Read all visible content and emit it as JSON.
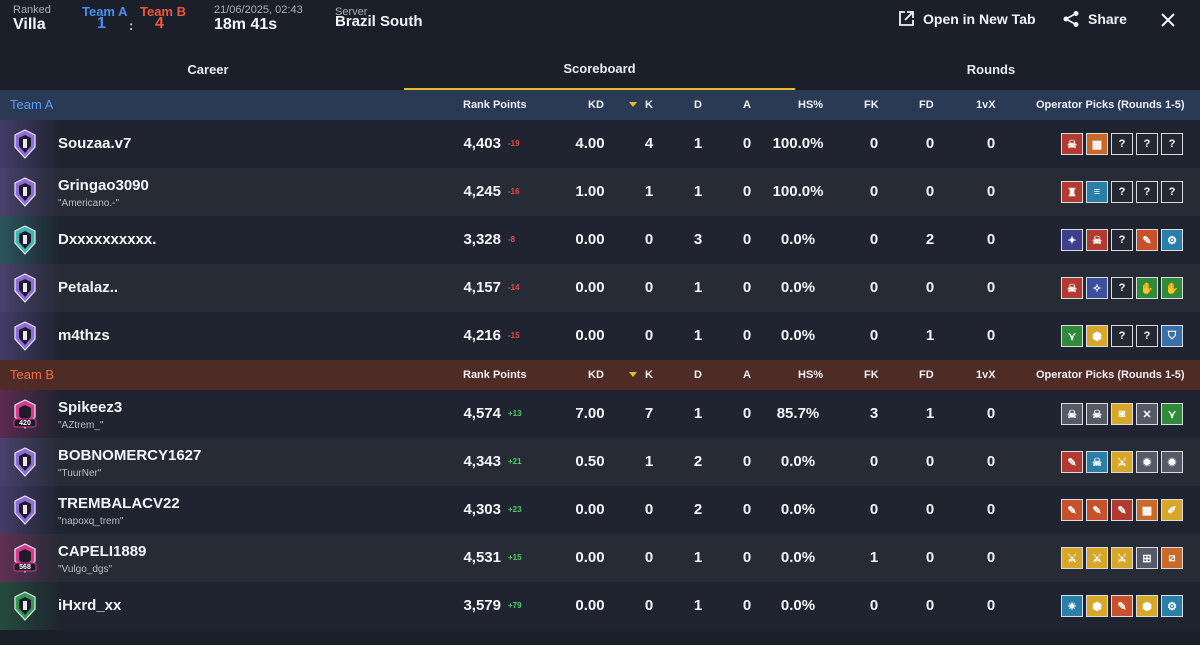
{
  "header": {
    "mode_label": "Ranked",
    "map": "Villa",
    "team_a_label": "Team A",
    "team_b_label": "Team B",
    "score_a": "1",
    "score_separator": ":",
    "score_b": "4",
    "datetime": "21/06/2025, 02:43",
    "duration": "18m 41s",
    "server_label": "Server",
    "server": "Brazil South",
    "open_new_tab": "Open in New Tab",
    "share": "Share"
  },
  "tabs": [
    {
      "label": "Career",
      "active": false
    },
    {
      "label": "Scoreboard",
      "active": true
    },
    {
      "label": "Rounds",
      "active": false
    }
  ],
  "columns": {
    "rank_points": "Rank Points",
    "kd": "KD",
    "k": "K",
    "d": "D",
    "a": "A",
    "hs": "HS%",
    "fk": "FK",
    "fd": "FD",
    "vx": "1vX",
    "ops": "Operator Picks (Rounds 1-5)"
  },
  "colors": {
    "team_a": "#4b8ff0",
    "team_b": "#ec5a3b",
    "accent": "#e3bd2c",
    "delta_negative": "#e64a4a",
    "delta_positive": "#4fcf6a"
  },
  "teams": [
    {
      "name": "Team A",
      "players": [
        {
          "name": "Souzaa.v7",
          "nickname": "",
          "rank_icon": "champion-rank-icon",
          "rank_color": "#8e6cd8",
          "rank_points": "4,403",
          "delta": "-19",
          "kd": "4.00",
          "k": "4",
          "d": "1",
          "a": "0",
          "hs": "100.0%",
          "fk": "0",
          "fd": "0",
          "vx": "0",
          "ops": [
            {
              "icon": "skull-operator-icon",
              "color": "#b23a30",
              "glyph": "☠"
            },
            {
              "icon": "hex-grid-operator-icon",
              "color": "#c86a2a",
              "glyph": "▦"
            },
            {
              "icon": "unknown-operator-icon",
              "color": "",
              "glyph": "?"
            },
            {
              "icon": "unknown-operator-icon",
              "color": "",
              "glyph": "?"
            },
            {
              "icon": "unknown-operator-icon",
              "color": "",
              "glyph": "?"
            }
          ]
        },
        {
          "name": "Gringao3090",
          "nickname": "\"Americano.-\"",
          "rank_icon": "diamond-rank-icon",
          "rank_color": "#8e6cd8",
          "rank_points": "4,245",
          "delta": "-16",
          "kd": "1.00",
          "k": "1",
          "d": "1",
          "a": "0",
          "hs": "100.0%",
          "fk": "0",
          "fd": "0",
          "vx": "0",
          "ops": [
            {
              "icon": "shield-operator-icon",
              "color": "#b23a30",
              "glyph": "♜"
            },
            {
              "icon": "barrier-operator-icon",
              "color": "#2a7fa8",
              "glyph": "≡"
            },
            {
              "icon": "unknown-operator-icon",
              "color": "",
              "glyph": "?"
            },
            {
              "icon": "unknown-operator-icon",
              "color": "",
              "glyph": "?"
            },
            {
              "icon": "unknown-operator-icon",
              "color": "",
              "glyph": "?"
            }
          ]
        },
        {
          "name": "Dxxxxxxxxxx.",
          "nickname": "",
          "rank_icon": "emerald-rank-icon",
          "rank_color": "#3fb6b0",
          "rank_points": "3,328",
          "delta": "-8",
          "kd": "0.00",
          "k": "0",
          "d": "3",
          "a": "0",
          "hs": "0.0%",
          "fk": "0",
          "fd": "2",
          "vx": "0",
          "ops": [
            {
              "icon": "raven-operator-icon",
              "color": "#3b3f8c",
              "glyph": "✦"
            },
            {
              "icon": "skull-operator-icon",
              "color": "#b23a30",
              "glyph": "☠"
            },
            {
              "icon": "unknown-operator-icon",
              "color": "",
              "glyph": "?"
            },
            {
              "icon": "drill-operator-icon",
              "color": "#c8502a",
              "glyph": "✎"
            },
            {
              "icon": "gadget-operator-icon",
              "color": "#2a7fa8",
              "glyph": "⚙"
            }
          ]
        },
        {
          "name": "Petalaz..",
          "nickname": "",
          "rank_icon": "diamond-rank-icon",
          "rank_color": "#8e6cd8",
          "rank_points": "4,157",
          "delta": "-14",
          "kd": "0.00",
          "k": "0",
          "d": "1",
          "a": "0",
          "hs": "0.0%",
          "fk": "0",
          "fd": "0",
          "vx": "0",
          "ops": [
            {
              "icon": "skull-operator-icon",
              "color": "#b23a30",
              "glyph": "☠"
            },
            {
              "icon": "wing-operator-icon",
              "color": "#3b4f9c",
              "glyph": "✧"
            },
            {
              "icon": "unknown-operator-icon",
              "color": "",
              "glyph": "?"
            },
            {
              "icon": "claw-operator-icon",
              "color": "#2f8a3a",
              "glyph": "✋"
            },
            {
              "icon": "claw-operator-icon",
              "color": "#2f8a3a",
              "glyph": "✋"
            }
          ]
        },
        {
          "name": "m4thzs",
          "nickname": "",
          "rank_icon": "diamond-rank-icon",
          "rank_color": "#8e6cd8",
          "rank_points": "4,216",
          "delta": "-15",
          "kd": "0.00",
          "k": "0",
          "d": "1",
          "a": "0",
          "hs": "0.0%",
          "fk": "0",
          "fd": "1",
          "vx": "0",
          "ops": [
            {
              "icon": "trap-operator-icon",
              "color": "#2f8a3a",
              "glyph": "⋎"
            },
            {
              "icon": "hex-operator-icon",
              "color": "#d8a72a",
              "glyph": "⬢"
            },
            {
              "icon": "unknown-operator-icon",
              "color": "",
              "glyph": "?"
            },
            {
              "icon": "unknown-operator-icon",
              "color": "",
              "glyph": "?"
            },
            {
              "icon": "armor-operator-icon",
              "color": "#3a6fa8",
              "glyph": "⛉"
            }
          ]
        }
      ]
    },
    {
      "name": "Team B",
      "players": [
        {
          "name": "Spikeez3",
          "nickname": "\"AZtrem_\"",
          "rank_icon": "champion-420-rank-icon",
          "rank_color": "#d63a8e",
          "rank_label": "420",
          "rank_points": "4,574",
          "delta": "+13",
          "kd": "7.00",
          "k": "7",
          "d": "1",
          "a": "0",
          "hs": "85.7%",
          "fk": "3",
          "fd": "1",
          "vx": "0",
          "ops": [
            {
              "icon": "skull-operator-icon",
              "color": "#555a66",
              "glyph": "☠"
            },
            {
              "icon": "skull-operator-icon",
              "color": "#555a66",
              "glyph": "☠"
            },
            {
              "icon": "visor-operator-icon",
              "color": "#d8a72a",
              "glyph": "◙"
            },
            {
              "icon": "crossed-operator-icon",
              "color": "#555a66",
              "glyph": "✕"
            },
            {
              "icon": "trap-operator-icon",
              "color": "#2f8a3a",
              "glyph": "⋎"
            }
          ]
        },
        {
          "name": "BOBNOMERCY1627",
          "nickname": "\"TuurNer\"",
          "rank_icon": "diamond-rank-icon",
          "rank_color": "#8e6cd8",
          "rank_points": "4,343",
          "delta": "+21",
          "kd": "0.50",
          "k": "1",
          "d": "2",
          "a": "0",
          "hs": "0.0%",
          "fk": "0",
          "fd": "0",
          "vx": "0",
          "ops": [
            {
              "icon": "drill-operator-icon",
              "color": "#b23a30",
              "glyph": "✎"
            },
            {
              "icon": "skull-operator-icon",
              "color": "#2a7fa8",
              "glyph": "☠"
            },
            {
              "icon": "blade-operator-icon",
              "color": "#d8a72a",
              "glyph": "⚔"
            },
            {
              "icon": "star-operator-icon",
              "color": "#555a66",
              "glyph": "✹"
            },
            {
              "icon": "star-operator-icon",
              "color": "#555a66",
              "glyph": "✹"
            }
          ]
        },
        {
          "name": "TREMBALACV22",
          "nickname": "\"napoxq_trem\"",
          "rank_icon": "diamond-rank-icon",
          "rank_color": "#8e6cd8",
          "rank_points": "4,303",
          "delta": "+23",
          "kd": "0.00",
          "k": "0",
          "d": "2",
          "a": "0",
          "hs": "0.0%",
          "fk": "0",
          "fd": "0",
          "vx": "0",
          "ops": [
            {
              "icon": "drill-operator-icon",
              "color": "#c8502a",
              "glyph": "✎"
            },
            {
              "icon": "drill-operator-icon",
              "color": "#c8502a",
              "glyph": "✎"
            },
            {
              "icon": "drill-operator-icon",
              "color": "#b23a30",
              "glyph": "✎"
            },
            {
              "icon": "hex-grid-operator-icon",
              "color": "#c86a2a",
              "glyph": "▦"
            },
            {
              "icon": "pen-operator-icon",
              "color": "#d8a72a",
              "glyph": "✐"
            }
          ]
        },
        {
          "name": "CAPELI1889",
          "nickname": "\"Vulgo_dgs\"",
          "rank_icon": "champion-568-rank-icon",
          "rank_color": "#d63a8e",
          "rank_label": "568",
          "rank_points": "4,531",
          "delta": "+15",
          "kd": "0.00",
          "k": "0",
          "d": "1",
          "a": "0",
          "hs": "0.0%",
          "fk": "1",
          "fd": "0",
          "vx": "0",
          "ops": [
            {
              "icon": "blade-operator-icon",
              "color": "#d8a72a",
              "glyph": "⚔"
            },
            {
              "icon": "blade-operator-icon",
              "color": "#d8a72a",
              "glyph": "⚔"
            },
            {
              "icon": "blade-operator-icon",
              "color": "#d8a72a",
              "glyph": "⚔"
            },
            {
              "icon": "grid-operator-icon",
              "color": "#555a66",
              "glyph": "⊞"
            },
            {
              "icon": "slash-operator-icon",
              "color": "#c86a2a",
              "glyph": "⧄"
            }
          ]
        },
        {
          "name": "iHxrd_xx",
          "nickname": "",
          "rank_icon": "emerald-rank-icon",
          "rank_color": "#2f9a55",
          "rank_points": "3,579",
          "delta": "+79",
          "kd": "0.00",
          "k": "0",
          "d": "1",
          "a": "0",
          "hs": "0.0%",
          "fk": "0",
          "fd": "0",
          "vx": "0",
          "ops": [
            {
              "icon": "burst-operator-icon",
              "color": "#2a7fa8",
              "glyph": "✷"
            },
            {
              "icon": "hive-operator-icon",
              "color": "#d8a72a",
              "glyph": "⬢"
            },
            {
              "icon": "drill-operator-icon",
              "color": "#c8502a",
              "glyph": "✎"
            },
            {
              "icon": "hex-operator-icon",
              "color": "#d8a72a",
              "glyph": "⬢"
            },
            {
              "icon": "gadget-operator-icon",
              "color": "#2a7fa8",
              "glyph": "⚙"
            }
          ]
        }
      ]
    }
  ]
}
